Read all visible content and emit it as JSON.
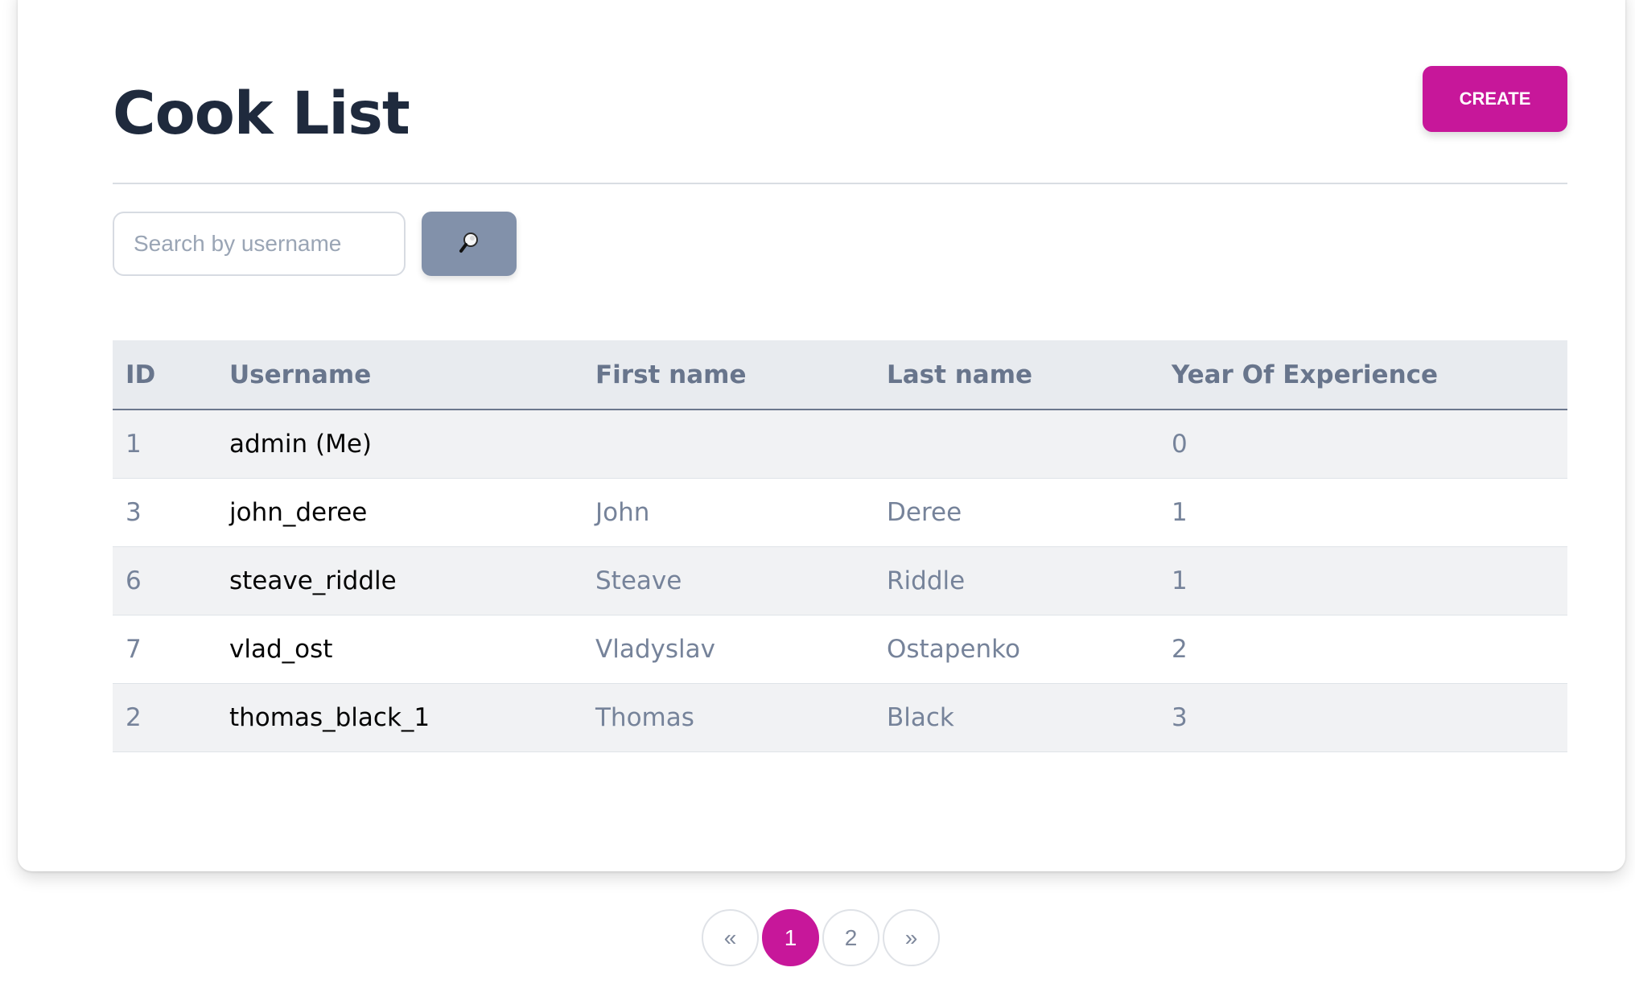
{
  "page": {
    "title": "Cook List",
    "create_label": "CREATE"
  },
  "search": {
    "placeholder": "Search by username",
    "value": "",
    "icon": "magnifying-glass-icon"
  },
  "table": {
    "headers": [
      "ID",
      "Username",
      "First name",
      "Last name",
      "Year Of Experience"
    ],
    "rows": [
      {
        "id": "1",
        "username": "admin (Me)",
        "first_name": "",
        "last_name": "",
        "years": "0"
      },
      {
        "id": "3",
        "username": "john_deree",
        "first_name": "John",
        "last_name": "Deree",
        "years": "1"
      },
      {
        "id": "6",
        "username": "steave_riddle",
        "first_name": "Steave",
        "last_name": "Riddle",
        "years": "1"
      },
      {
        "id": "7",
        "username": "vlad_ost",
        "first_name": "Vladyslav",
        "last_name": "Ostapenko",
        "years": "2"
      },
      {
        "id": "2",
        "username": "thomas_black_1",
        "first_name": "Thomas",
        "last_name": "Black",
        "years": "3"
      }
    ]
  },
  "pagination": {
    "prev_label": "«",
    "pages": [
      "1",
      "2"
    ],
    "current_page": "1",
    "next_label": "»"
  },
  "colors": {
    "accent": "#c7179a",
    "search_button": "#8291aa",
    "title": "#1f2a3d"
  }
}
